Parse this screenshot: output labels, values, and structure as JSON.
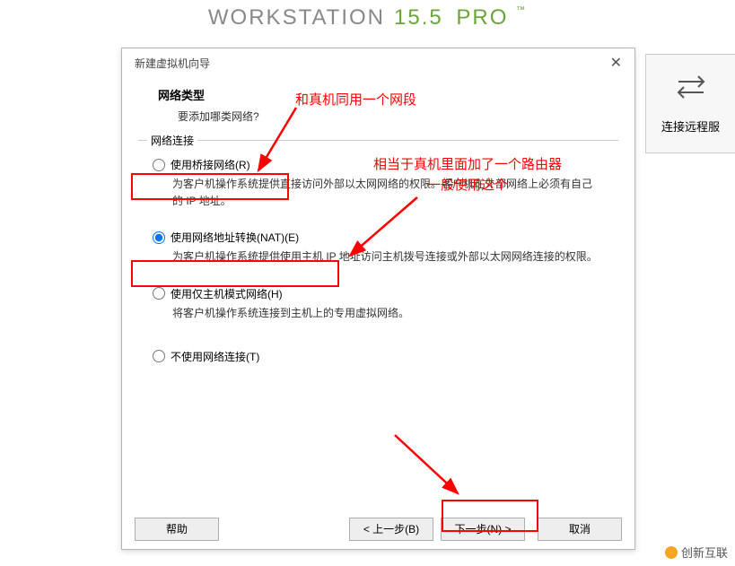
{
  "brand": {
    "name": "WORKSTATION",
    "version": "15.5",
    "edition": "PRO",
    "tm": "™"
  },
  "rightPanel": {
    "label": "连接远程服"
  },
  "dialog": {
    "title": "新建虚拟机向导",
    "heading": "网络类型",
    "subheading": "要添加哪类网络?",
    "fieldsetLabel": "网络连接",
    "options": [
      {
        "label": "使用桥接网络(R)",
        "desc": "为客户机操作系统提供直接访问外部以太网网络的权限。客户机在外部网络上必须有自己的 IP 地址。",
        "checked": false
      },
      {
        "label": "使用网络地址转换(NAT)(E)",
        "desc": "为客户机操作系统提供使用主机 IP 地址访问主机拨号连接或外部以太网网络连接的权限。",
        "checked": true
      },
      {
        "label": "使用仅主机模式网络(H)",
        "desc": "将客户机操作系统连接到主机上的专用虚拟网络。",
        "checked": false
      },
      {
        "label": "不使用网络连接(T)",
        "desc": "",
        "checked": false
      }
    ],
    "buttons": {
      "help": "帮助",
      "back": "< 上一步(B)",
      "next": "下一步(N) >",
      "cancel": "取消"
    }
  },
  "annotations": {
    "a1": "和真机同用一个网段",
    "a2_line1": "相当于真机里面加了一个路由器",
    "a2_line2": "一般使用这个"
  },
  "watermark": "创新互联"
}
